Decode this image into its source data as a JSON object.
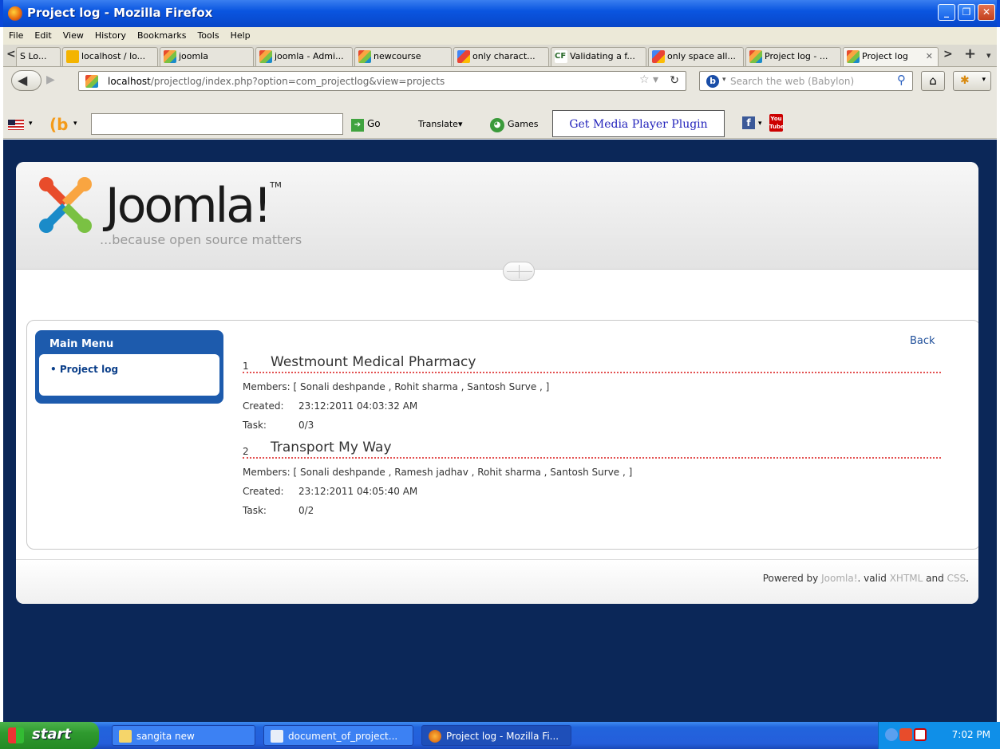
{
  "window": {
    "title": "Project log - Mozilla Firefox"
  },
  "menubar": [
    "File",
    "Edit",
    "View",
    "History",
    "Bookmarks",
    "Tools",
    "Help"
  ],
  "tabs": [
    {
      "label": "S Lo...",
      "icon": "nav-left"
    },
    {
      "label": "localhost / lo...",
      "icon": "pma"
    },
    {
      "label": "joomla",
      "icon": "joomla"
    },
    {
      "label": "joomla - Admi...",
      "icon": "joomla"
    },
    {
      "label": "newcourse",
      "icon": "joomla"
    },
    {
      "label": "only charact...",
      "icon": "google"
    },
    {
      "label": "Validating a f...",
      "icon": "cf"
    },
    {
      "label": "only space all...",
      "icon": "google"
    },
    {
      "label": "Project log - ...",
      "icon": "joomla"
    },
    {
      "label": "Project log",
      "icon": "joomla",
      "active": true
    }
  ],
  "nav": {
    "url_host": "localhost",
    "url_path": "/projectlog/index.php?option=com_projectlog&view=projects",
    "search_placeholder": "Search the web (Babylon)"
  },
  "babylon": {
    "go_label": "Go",
    "translate_label": "Translate",
    "games_label": "Games",
    "media_plugin": "Get Media Player Plugin"
  },
  "site": {
    "brand": "Joomla!",
    "tm": "TM",
    "tagline": "...because open source matters",
    "menu": {
      "title": "Main Menu",
      "items": [
        "Project log"
      ]
    },
    "back_label": "Back",
    "labels": {
      "members": "Members:",
      "created": "Created:",
      "task": "Task:"
    },
    "projects": [
      {
        "num": "1",
        "name": "Westmount Medical Pharmacy",
        "members": "[ Sonali deshpande , Rohit sharma , Santosh Surve , ]",
        "created": "23:12:2011 04:03:32 AM",
        "task": "0/3"
      },
      {
        "num": "2",
        "name": "Transport My Way",
        "members": "[ Sonali deshpande , Ramesh jadhav , Rohit sharma , Santosh Surve , ]",
        "created": "23:12:2011 04:05:40 AM",
        "task": "0/2"
      }
    ],
    "footer": {
      "prefix": "Powered by ",
      "joomla": "Joomla!",
      "mid": ". valid ",
      "xhtml": "XHTML",
      "and": " and ",
      "css": "CSS",
      "end": "."
    }
  },
  "taskbar": {
    "start": "start",
    "buttons": [
      "sangita new",
      "document_of_project...",
      "Project log - Mozilla Fi..."
    ],
    "clock": "7:02 PM"
  }
}
